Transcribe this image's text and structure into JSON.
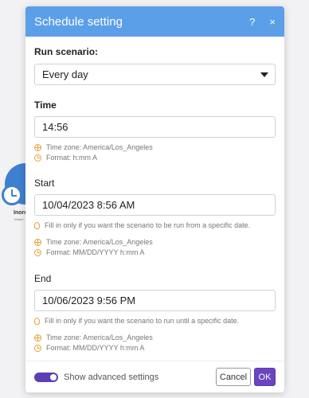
{
  "background": {
    "module_label": "Inoreader",
    "module_sublabel": "Watch..."
  },
  "dialog": {
    "title": "Schedule setting",
    "help_icon": "?",
    "close_icon": "×"
  },
  "run_scenario": {
    "label": "Run scenario:",
    "value": "Every day"
  },
  "time": {
    "label": "Time",
    "value": "14:56",
    "timezone": "Time zone: America/Los_Angeles",
    "format": "Format: h:mm A"
  },
  "start": {
    "label": "Start",
    "value": "10/04/2023 8:56 AM",
    "hint": "Fill in only if you want the scenario to be run from a specific date.",
    "timezone": "Time zone: America/Los_Angeles",
    "format": "Format: MM/DD/YYYY h:mm A"
  },
  "end": {
    "label": "End",
    "value": "10/06/2023 9:56 PM",
    "hint": "Fill in only if you want the scenario to run until a specific date.",
    "timezone": "Time zone: America/Los_Angeles",
    "format": "Format: MM/DD/YYYY h:mm A"
  },
  "footer": {
    "advanced_label": "Show advanced settings",
    "advanced_enabled": true,
    "cancel_label": "Cancel",
    "ok_label": "OK"
  },
  "colors": {
    "header": "#5b9fe9",
    "accent": "#6a45be",
    "hint_icon": "#e5a230"
  }
}
